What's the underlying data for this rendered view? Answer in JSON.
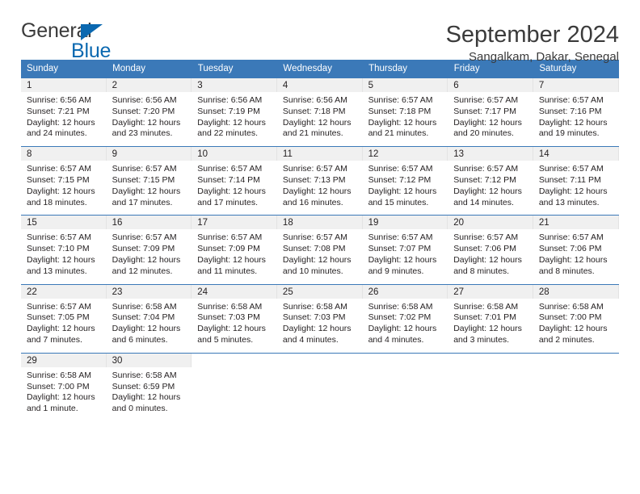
{
  "brand": {
    "name_part1": "General",
    "name_part2": "Blue",
    "triangle_color": "#0a68b0"
  },
  "header": {
    "title": "September 2024",
    "location": "Sangalkam, Dakar, Senegal"
  },
  "theme": {
    "header_blue": "#3b79b8",
    "daynum_gray": "#f0f0f0",
    "text": "#231f20"
  },
  "weekdays": [
    "Sunday",
    "Monday",
    "Tuesday",
    "Wednesday",
    "Thursday",
    "Friday",
    "Saturday"
  ],
  "weeks": [
    [
      {
        "day": "1",
        "sunrise": "Sunrise: 6:56 AM",
        "sunset": "Sunset: 7:21 PM",
        "daylight1": "Daylight: 12 hours",
        "daylight2": "and 24 minutes."
      },
      {
        "day": "2",
        "sunrise": "Sunrise: 6:56 AM",
        "sunset": "Sunset: 7:20 PM",
        "daylight1": "Daylight: 12 hours",
        "daylight2": "and 23 minutes."
      },
      {
        "day": "3",
        "sunrise": "Sunrise: 6:56 AM",
        "sunset": "Sunset: 7:19 PM",
        "daylight1": "Daylight: 12 hours",
        "daylight2": "and 22 minutes."
      },
      {
        "day": "4",
        "sunrise": "Sunrise: 6:56 AM",
        "sunset": "Sunset: 7:18 PM",
        "daylight1": "Daylight: 12 hours",
        "daylight2": "and 21 minutes."
      },
      {
        "day": "5",
        "sunrise": "Sunrise: 6:57 AM",
        "sunset": "Sunset: 7:18 PM",
        "daylight1": "Daylight: 12 hours",
        "daylight2": "and 21 minutes."
      },
      {
        "day": "6",
        "sunrise": "Sunrise: 6:57 AM",
        "sunset": "Sunset: 7:17 PM",
        "daylight1": "Daylight: 12 hours",
        "daylight2": "and 20 minutes."
      },
      {
        "day": "7",
        "sunrise": "Sunrise: 6:57 AM",
        "sunset": "Sunset: 7:16 PM",
        "daylight1": "Daylight: 12 hours",
        "daylight2": "and 19 minutes."
      }
    ],
    [
      {
        "day": "8",
        "sunrise": "Sunrise: 6:57 AM",
        "sunset": "Sunset: 7:15 PM",
        "daylight1": "Daylight: 12 hours",
        "daylight2": "and 18 minutes."
      },
      {
        "day": "9",
        "sunrise": "Sunrise: 6:57 AM",
        "sunset": "Sunset: 7:15 PM",
        "daylight1": "Daylight: 12 hours",
        "daylight2": "and 17 minutes."
      },
      {
        "day": "10",
        "sunrise": "Sunrise: 6:57 AM",
        "sunset": "Sunset: 7:14 PM",
        "daylight1": "Daylight: 12 hours",
        "daylight2": "and 17 minutes."
      },
      {
        "day": "11",
        "sunrise": "Sunrise: 6:57 AM",
        "sunset": "Sunset: 7:13 PM",
        "daylight1": "Daylight: 12 hours",
        "daylight2": "and 16 minutes."
      },
      {
        "day": "12",
        "sunrise": "Sunrise: 6:57 AM",
        "sunset": "Sunset: 7:12 PM",
        "daylight1": "Daylight: 12 hours",
        "daylight2": "and 15 minutes."
      },
      {
        "day": "13",
        "sunrise": "Sunrise: 6:57 AM",
        "sunset": "Sunset: 7:12 PM",
        "daylight1": "Daylight: 12 hours",
        "daylight2": "and 14 minutes."
      },
      {
        "day": "14",
        "sunrise": "Sunrise: 6:57 AM",
        "sunset": "Sunset: 7:11 PM",
        "daylight1": "Daylight: 12 hours",
        "daylight2": "and 13 minutes."
      }
    ],
    [
      {
        "day": "15",
        "sunrise": "Sunrise: 6:57 AM",
        "sunset": "Sunset: 7:10 PM",
        "daylight1": "Daylight: 12 hours",
        "daylight2": "and 13 minutes."
      },
      {
        "day": "16",
        "sunrise": "Sunrise: 6:57 AM",
        "sunset": "Sunset: 7:09 PM",
        "daylight1": "Daylight: 12 hours",
        "daylight2": "and 12 minutes."
      },
      {
        "day": "17",
        "sunrise": "Sunrise: 6:57 AM",
        "sunset": "Sunset: 7:09 PM",
        "daylight1": "Daylight: 12 hours",
        "daylight2": "and 11 minutes."
      },
      {
        "day": "18",
        "sunrise": "Sunrise: 6:57 AM",
        "sunset": "Sunset: 7:08 PM",
        "daylight1": "Daylight: 12 hours",
        "daylight2": "and 10 minutes."
      },
      {
        "day": "19",
        "sunrise": "Sunrise: 6:57 AM",
        "sunset": "Sunset: 7:07 PM",
        "daylight1": "Daylight: 12 hours",
        "daylight2": "and 9 minutes."
      },
      {
        "day": "20",
        "sunrise": "Sunrise: 6:57 AM",
        "sunset": "Sunset: 7:06 PM",
        "daylight1": "Daylight: 12 hours",
        "daylight2": "and 8 minutes."
      },
      {
        "day": "21",
        "sunrise": "Sunrise: 6:57 AM",
        "sunset": "Sunset: 7:06 PM",
        "daylight1": "Daylight: 12 hours",
        "daylight2": "and 8 minutes."
      }
    ],
    [
      {
        "day": "22",
        "sunrise": "Sunrise: 6:57 AM",
        "sunset": "Sunset: 7:05 PM",
        "daylight1": "Daylight: 12 hours",
        "daylight2": "and 7 minutes."
      },
      {
        "day": "23",
        "sunrise": "Sunrise: 6:58 AM",
        "sunset": "Sunset: 7:04 PM",
        "daylight1": "Daylight: 12 hours",
        "daylight2": "and 6 minutes."
      },
      {
        "day": "24",
        "sunrise": "Sunrise: 6:58 AM",
        "sunset": "Sunset: 7:03 PM",
        "daylight1": "Daylight: 12 hours",
        "daylight2": "and 5 minutes."
      },
      {
        "day": "25",
        "sunrise": "Sunrise: 6:58 AM",
        "sunset": "Sunset: 7:03 PM",
        "daylight1": "Daylight: 12 hours",
        "daylight2": "and 4 minutes."
      },
      {
        "day": "26",
        "sunrise": "Sunrise: 6:58 AM",
        "sunset": "Sunset: 7:02 PM",
        "daylight1": "Daylight: 12 hours",
        "daylight2": "and 4 minutes."
      },
      {
        "day": "27",
        "sunrise": "Sunrise: 6:58 AM",
        "sunset": "Sunset: 7:01 PM",
        "daylight1": "Daylight: 12 hours",
        "daylight2": "and 3 minutes."
      },
      {
        "day": "28",
        "sunrise": "Sunrise: 6:58 AM",
        "sunset": "Sunset: 7:00 PM",
        "daylight1": "Daylight: 12 hours",
        "daylight2": "and 2 minutes."
      }
    ],
    [
      {
        "day": "29",
        "sunrise": "Sunrise: 6:58 AM",
        "sunset": "Sunset: 7:00 PM",
        "daylight1": "Daylight: 12 hours",
        "daylight2": "and 1 minute."
      },
      {
        "day": "30",
        "sunrise": "Sunrise: 6:58 AM",
        "sunset": "Sunset: 6:59 PM",
        "daylight1": "Daylight: 12 hours",
        "daylight2": "and 0 minutes."
      },
      {
        "day": "",
        "sunrise": "",
        "sunset": "",
        "daylight1": "",
        "daylight2": ""
      },
      {
        "day": "",
        "sunrise": "",
        "sunset": "",
        "daylight1": "",
        "daylight2": ""
      },
      {
        "day": "",
        "sunrise": "",
        "sunset": "",
        "daylight1": "",
        "daylight2": ""
      },
      {
        "day": "",
        "sunrise": "",
        "sunset": "",
        "daylight1": "",
        "daylight2": ""
      },
      {
        "day": "",
        "sunrise": "",
        "sunset": "",
        "daylight1": "",
        "daylight2": ""
      }
    ]
  ]
}
